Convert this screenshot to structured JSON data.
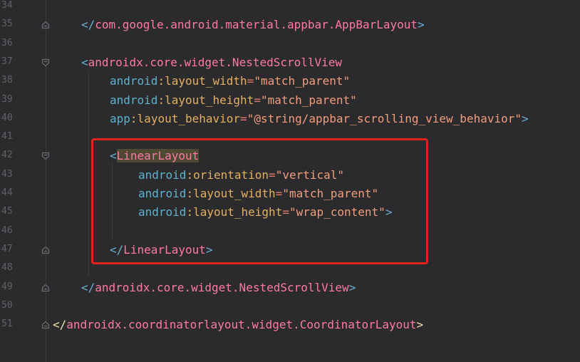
{
  "editor": {
    "lines": [
      {
        "number": "34",
        "indent": 0,
        "fold": "none",
        "tokens": []
      },
      {
        "number": "35",
        "indent": 1,
        "fold": "end",
        "tokens": [
          {
            "t": "</",
            "k": "bracket"
          },
          {
            "t": "com.google.android.material.appbar.AppBarLayout",
            "k": "tag"
          },
          {
            "t": ">",
            "k": "bracket"
          }
        ]
      },
      {
        "number": "36",
        "indent": 0,
        "fold": "none",
        "tokens": []
      },
      {
        "number": "37",
        "indent": 1,
        "fold": "start",
        "tokens": [
          {
            "t": "<",
            "k": "bracket"
          },
          {
            "t": "androidx.core.widget.NestedScrollView",
            "k": "tag"
          }
        ]
      },
      {
        "number": "38",
        "indent": 2,
        "fold": "none",
        "tokens": [
          {
            "t": "android",
            "k": "ns"
          },
          {
            "t": ":",
            "k": "colon"
          },
          {
            "t": "layout_width",
            "k": "attr"
          },
          {
            "t": "=",
            "k": "eq"
          },
          {
            "t": "\"match_parent\"",
            "k": "str"
          }
        ]
      },
      {
        "number": "39",
        "indent": 2,
        "fold": "none",
        "tokens": [
          {
            "t": "android",
            "k": "ns"
          },
          {
            "t": ":",
            "k": "colon"
          },
          {
            "t": "layout_height",
            "k": "attr"
          },
          {
            "t": "=",
            "k": "eq"
          },
          {
            "t": "\"match_parent\"",
            "k": "str"
          }
        ]
      },
      {
        "number": "40",
        "indent": 2,
        "fold": "none",
        "tokens": [
          {
            "t": "app",
            "k": "ns"
          },
          {
            "t": ":",
            "k": "colon"
          },
          {
            "t": "layout_behavior",
            "k": "attr"
          },
          {
            "t": "=",
            "k": "eq"
          },
          {
            "t": "\"@string/appbar_scrolling_view_behavior\"",
            "k": "str"
          },
          {
            "t": ">",
            "k": "bracket"
          }
        ]
      },
      {
        "number": "41",
        "indent": 0,
        "fold": "none",
        "tokens": []
      },
      {
        "number": "42",
        "indent": 2,
        "fold": "start",
        "tokens": [
          {
            "t": "<",
            "k": "bracket"
          },
          {
            "t": "LinearLayout",
            "k": "tag-hl"
          }
        ]
      },
      {
        "number": "43",
        "indent": 3,
        "fold": "none",
        "tokens": [
          {
            "t": "android",
            "k": "ns"
          },
          {
            "t": ":",
            "k": "colon"
          },
          {
            "t": "orientation",
            "k": "attr"
          },
          {
            "t": "=",
            "k": "eq"
          },
          {
            "t": "\"vertical\"",
            "k": "str"
          }
        ]
      },
      {
        "number": "44",
        "indent": 3,
        "fold": "none",
        "tokens": [
          {
            "t": "android",
            "k": "ns"
          },
          {
            "t": ":",
            "k": "colon"
          },
          {
            "t": "layout_width",
            "k": "attr"
          },
          {
            "t": "=",
            "k": "eq"
          },
          {
            "t": "\"match_parent\"",
            "k": "str"
          }
        ]
      },
      {
        "number": "45",
        "indent": 3,
        "fold": "none",
        "tokens": [
          {
            "t": "android",
            "k": "ns"
          },
          {
            "t": ":",
            "k": "colon"
          },
          {
            "t": "layout_height",
            "k": "attr"
          },
          {
            "t": "=",
            "k": "eq"
          },
          {
            "t": "\"wrap_content\"",
            "k": "str"
          },
          {
            "t": ">",
            "k": "bracket"
          }
        ]
      },
      {
        "number": "46",
        "indent": 0,
        "fold": "none",
        "tokens": []
      },
      {
        "number": "47",
        "indent": 2,
        "fold": "end",
        "tokens": [
          {
            "t": "</",
            "k": "bracket"
          },
          {
            "t": "LinearLayout",
            "k": "tag"
          },
          {
            "t": ">",
            "k": "bracket"
          }
        ]
      },
      {
        "number": "48",
        "indent": 0,
        "fold": "none",
        "tokens": []
      },
      {
        "number": "49",
        "indent": 1,
        "fold": "end",
        "tokens": [
          {
            "t": "</",
            "k": "bracket"
          },
          {
            "t": "androidx.core.widget.NestedScrollView",
            "k": "tag"
          },
          {
            "t": ">",
            "k": "bracket"
          }
        ]
      },
      {
        "number": "50",
        "indent": 0,
        "fold": "none",
        "tokens": []
      },
      {
        "number": "51",
        "indent": 0,
        "fold": "end",
        "tokens": [
          {
            "t": "</",
            "k": "punct"
          },
          {
            "t": "androidx.coordinatorlayout.widget.CoordinatorLayout",
            "k": "tag"
          },
          {
            "t": ">",
            "k": "punct"
          }
        ]
      }
    ]
  },
  "highlight": {
    "color": "#e2231c",
    "covers_lines": [
      "42",
      "47"
    ]
  },
  "icons": {
    "fold_start": "fold-start-icon",
    "fold_end": "fold-end-icon"
  }
}
